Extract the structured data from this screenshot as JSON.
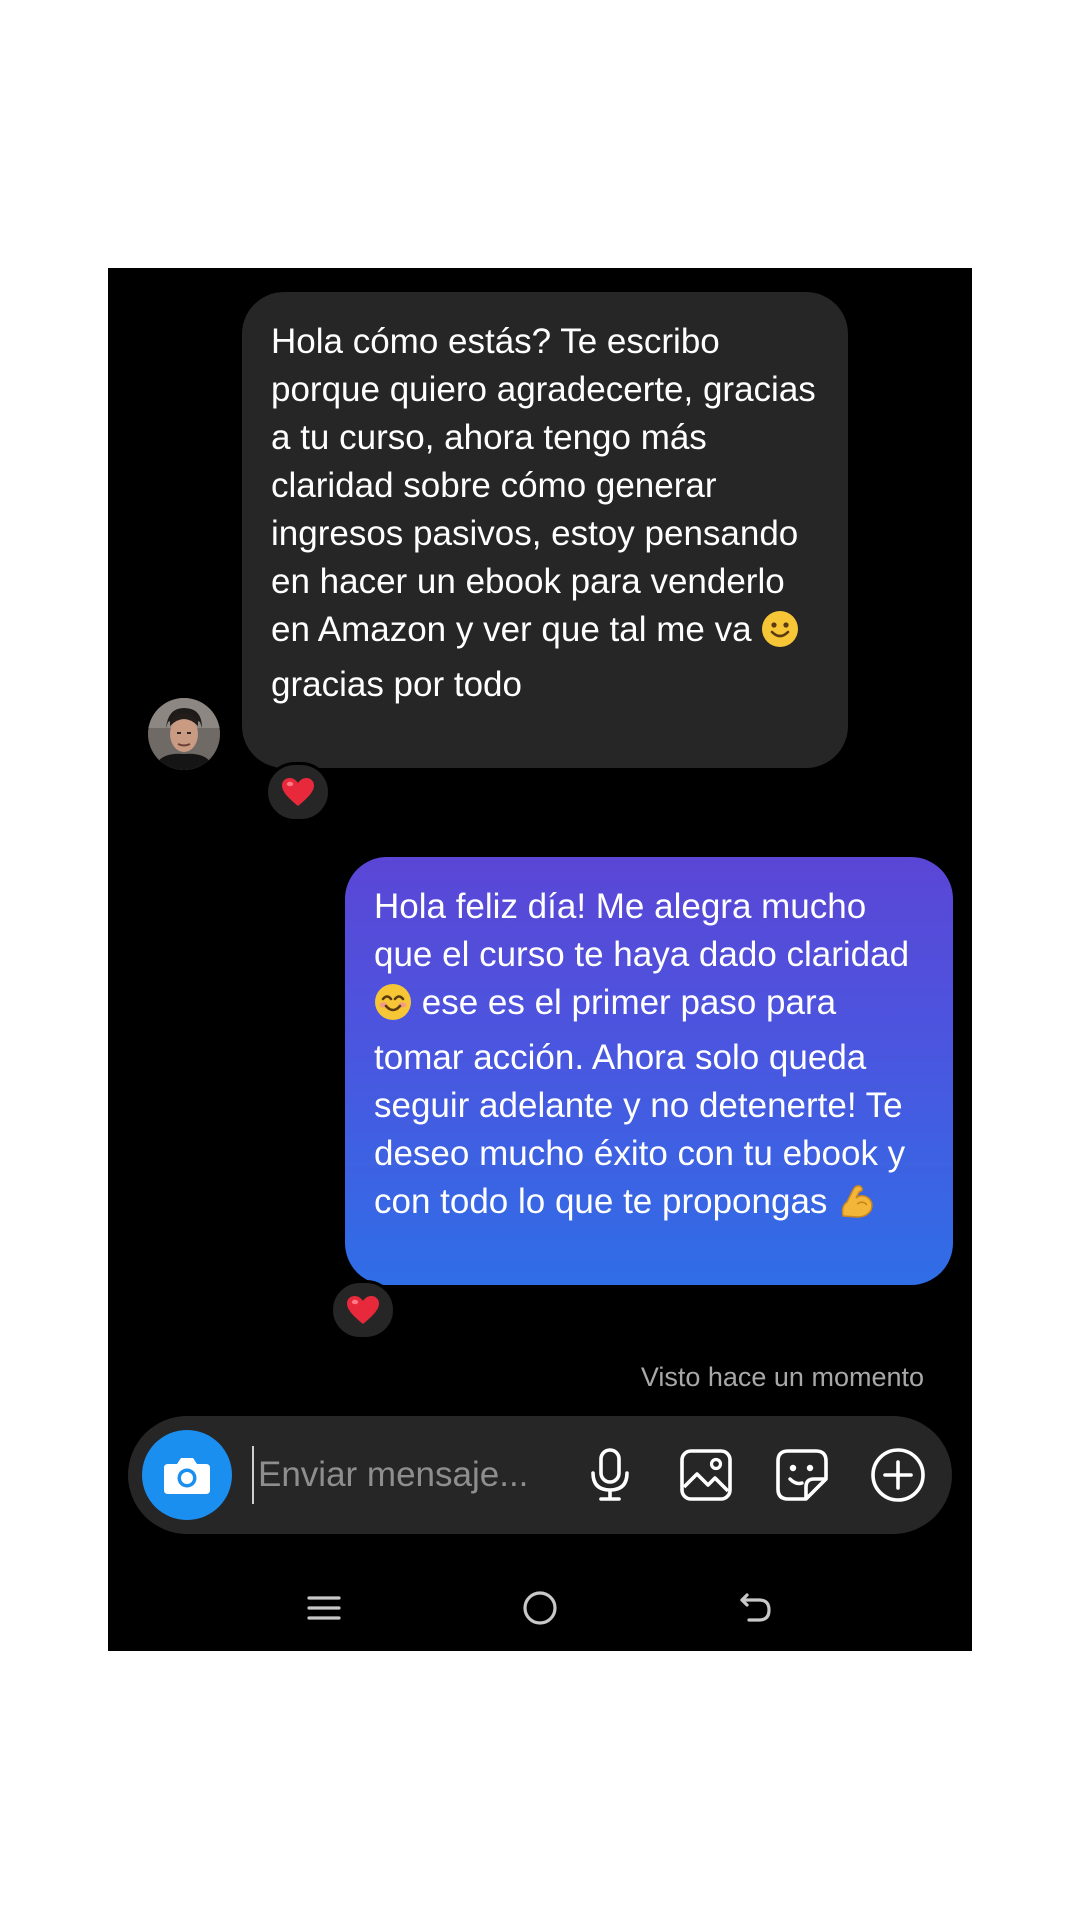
{
  "conversation": {
    "incoming": {
      "text_before_emoji": "Hola cómo estás? Te escribo porque quiero agradecerte, gracias a tu curso, ahora tengo más claridad sobre cómo generar ingresos pasivos, estoy pensando en hacer un ebook para venderlo en Amazon y ver que tal me va",
      "emoji": "slightly-smiling-face",
      "text_after_emoji": "gracias por todo",
      "reaction": "red-heart"
    },
    "outgoing": {
      "text_part1": "Hola feliz día! Me alegra mucho que el curso te haya dado claridad",
      "emoji1": "smiling-face-with-smiling-eyes",
      "text_part2": "ese es el primer paso para tomar acción. Ahora solo queda seguir adelante y no detenerte! Te deseo mucho éxito con tu ebook y con todo lo que te propongas",
      "emoji2": "flexed-biceps",
      "reaction": "red-heart"
    },
    "seen_status": "Visto hace un momento"
  },
  "composer": {
    "placeholder": "Enviar mensaje...",
    "icons": [
      "camera-icon",
      "microphone-icon",
      "gallery-icon",
      "sticker-icon",
      "plus-icon"
    ]
  },
  "navigation": {
    "icons": [
      "recents-icon",
      "home-icon",
      "back-icon"
    ]
  },
  "colors": {
    "background": "#000000",
    "incoming_bubble": "#262626",
    "outgoing_gradient_top": "#5b46d6",
    "outgoing_gradient_bottom": "#2f6ee6",
    "camera_button": "#1b8ff0",
    "seen_text": "#a8a8a8"
  }
}
